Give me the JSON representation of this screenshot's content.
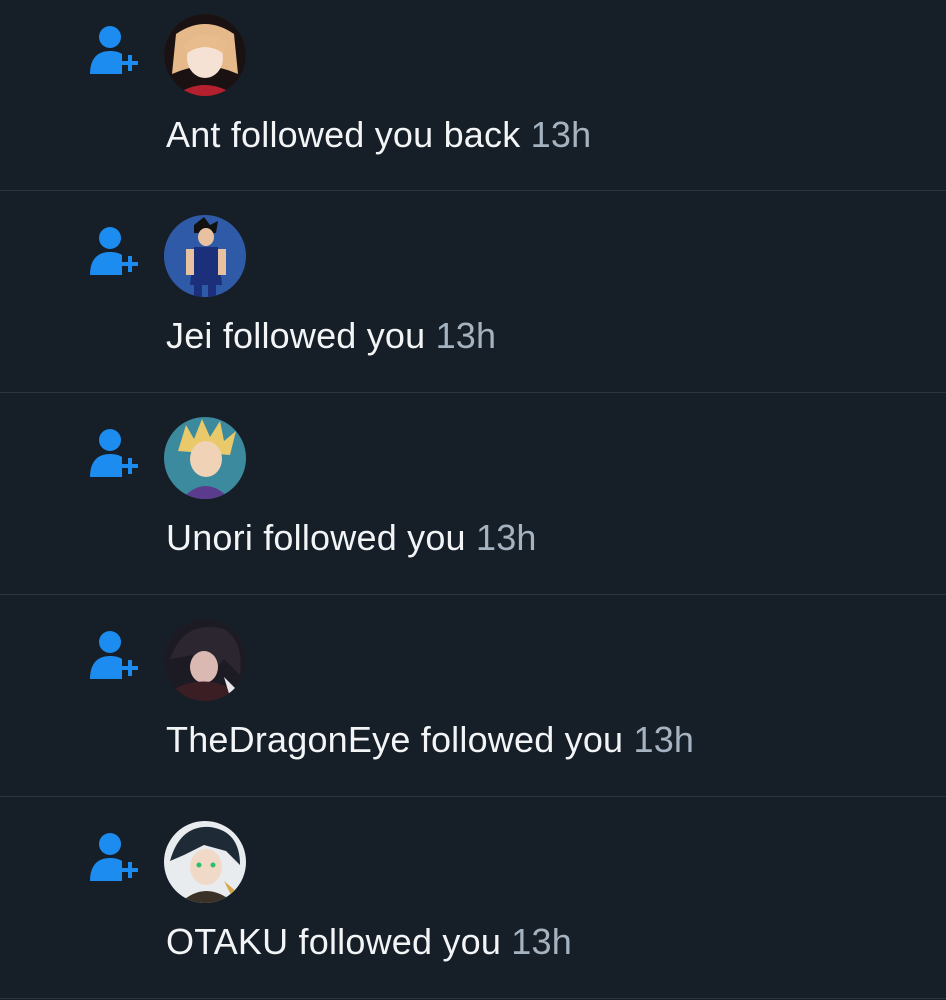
{
  "colors": {
    "background": "#161e27",
    "divider": "#2a3440",
    "accent": "#1d8cf0",
    "text": "#f2f4f6",
    "timestamp": "#a5b3c1"
  },
  "notifications": [
    {
      "icon": "person-add-icon",
      "user": "Ant",
      "action": "followed you back",
      "time": "13h",
      "avatar": "anime-girl-blonde"
    },
    {
      "icon": "person-add-icon",
      "user": "Jei",
      "action": "followed you",
      "time": "13h",
      "avatar": "anime-saiyan-blue"
    },
    {
      "icon": "person-add-icon",
      "user": "Unori",
      "action": "followed you",
      "time": "13h",
      "avatar": "anime-spiky-blond"
    },
    {
      "icon": "person-add-icon",
      "user": "TheDragonEye",
      "action": "followed you",
      "time": "13h",
      "avatar": "anime-dark-hair"
    },
    {
      "icon": "person-add-icon",
      "user": "OTAKU",
      "action": "followed you",
      "time": "13h",
      "avatar": "anime-green-eyes"
    }
  ]
}
